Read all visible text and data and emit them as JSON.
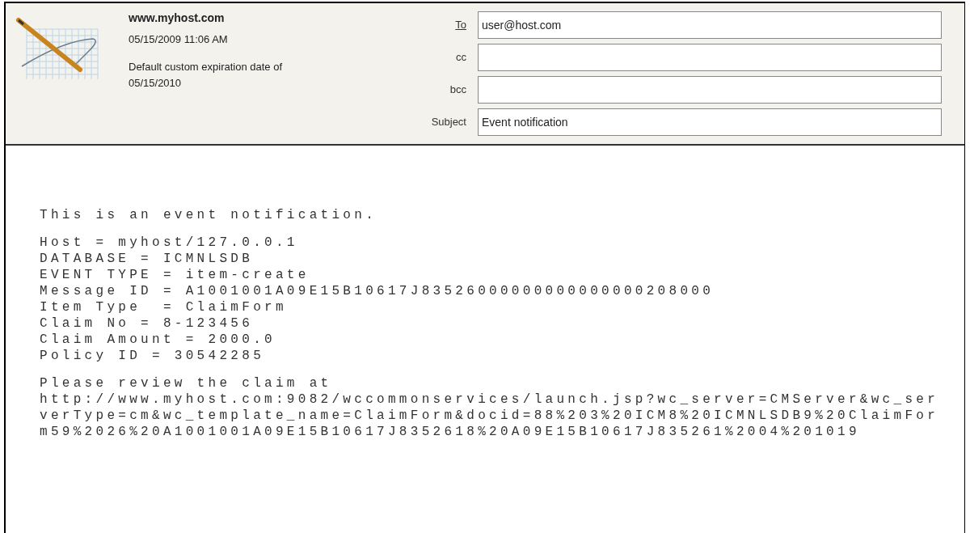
{
  "header": {
    "site": "www.myhost.com",
    "date": "05/15/2009 11:06 AM",
    "expiration": [
      "Default custom expiration date of",
      "05/15/2010"
    ]
  },
  "fields": [
    {
      "label": "To",
      "kind": "link",
      "value": "user@host.com"
    },
    {
      "label": "cc",
      "kind": "plain"
    },
    {
      "label": "bcc",
      "kind": "plain"
    },
    {
      "label": "Subject",
      "kind": "plain",
      "value": "Event notification"
    }
  ],
  "body": {
    "paragraphs": [
      [
        "This is an event notification."
      ],
      [
        "Host = myhost/127.0.0.1",
        "DATABASE = ICMNLSDB",
        "EVENT TYPE = item-create",
        "Message ID = A1001001A09E15B10617J83526000000000000000208000",
        "Item Type  = ClaimForm",
        "Claim No = 8-123456",
        "Claim Amount = 2000.0",
        "Policy ID = 30542285"
      ],
      [
        "Please review the claim at",
        "http://www.myhost.com:9082/wccommonservices/launch.jsp?wc_server=CMServer&wc_ser",
        "verType=cm&wc_template_name=ClaimForm&docid=88%203%20ICM8%20ICMNLSDB9%20ClaimFor",
        "m59%2026%20A1001001A09E15B10617J8352618%20A09E15B10617J835261%2004%201019"
      ]
    ]
  }
}
